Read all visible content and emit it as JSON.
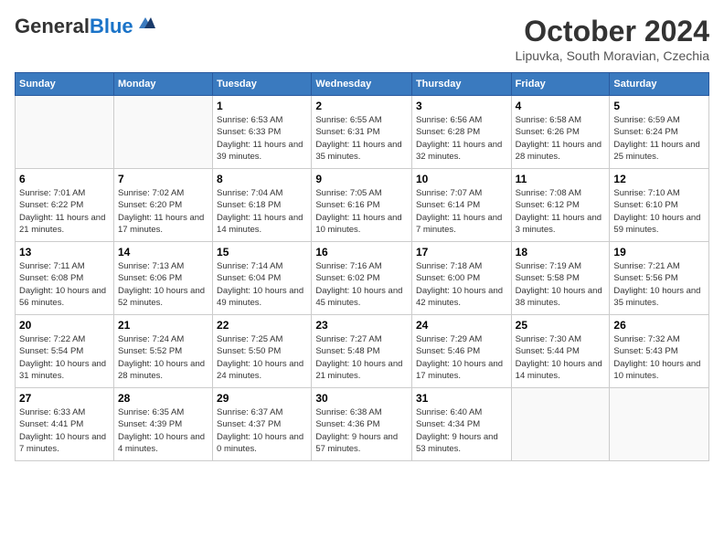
{
  "header": {
    "logo_general": "General",
    "logo_blue": "Blue",
    "title": "October 2024",
    "subtitle": "Lipuvka, South Moravian, Czechia"
  },
  "days_of_week": [
    "Sunday",
    "Monday",
    "Tuesday",
    "Wednesday",
    "Thursday",
    "Friday",
    "Saturday"
  ],
  "weeks": [
    [
      {
        "day": "",
        "info": ""
      },
      {
        "day": "",
        "info": ""
      },
      {
        "day": "1",
        "info": "Sunrise: 6:53 AM\nSunset: 6:33 PM\nDaylight: 11 hours and 39 minutes."
      },
      {
        "day": "2",
        "info": "Sunrise: 6:55 AM\nSunset: 6:31 PM\nDaylight: 11 hours and 35 minutes."
      },
      {
        "day": "3",
        "info": "Sunrise: 6:56 AM\nSunset: 6:28 PM\nDaylight: 11 hours and 32 minutes."
      },
      {
        "day": "4",
        "info": "Sunrise: 6:58 AM\nSunset: 6:26 PM\nDaylight: 11 hours and 28 minutes."
      },
      {
        "day": "5",
        "info": "Sunrise: 6:59 AM\nSunset: 6:24 PM\nDaylight: 11 hours and 25 minutes."
      }
    ],
    [
      {
        "day": "6",
        "info": "Sunrise: 7:01 AM\nSunset: 6:22 PM\nDaylight: 11 hours and 21 minutes."
      },
      {
        "day": "7",
        "info": "Sunrise: 7:02 AM\nSunset: 6:20 PM\nDaylight: 11 hours and 17 minutes."
      },
      {
        "day": "8",
        "info": "Sunrise: 7:04 AM\nSunset: 6:18 PM\nDaylight: 11 hours and 14 minutes."
      },
      {
        "day": "9",
        "info": "Sunrise: 7:05 AM\nSunset: 6:16 PM\nDaylight: 11 hours and 10 minutes."
      },
      {
        "day": "10",
        "info": "Sunrise: 7:07 AM\nSunset: 6:14 PM\nDaylight: 11 hours and 7 minutes."
      },
      {
        "day": "11",
        "info": "Sunrise: 7:08 AM\nSunset: 6:12 PM\nDaylight: 11 hours and 3 minutes."
      },
      {
        "day": "12",
        "info": "Sunrise: 7:10 AM\nSunset: 6:10 PM\nDaylight: 10 hours and 59 minutes."
      }
    ],
    [
      {
        "day": "13",
        "info": "Sunrise: 7:11 AM\nSunset: 6:08 PM\nDaylight: 10 hours and 56 minutes."
      },
      {
        "day": "14",
        "info": "Sunrise: 7:13 AM\nSunset: 6:06 PM\nDaylight: 10 hours and 52 minutes."
      },
      {
        "day": "15",
        "info": "Sunrise: 7:14 AM\nSunset: 6:04 PM\nDaylight: 10 hours and 49 minutes."
      },
      {
        "day": "16",
        "info": "Sunrise: 7:16 AM\nSunset: 6:02 PM\nDaylight: 10 hours and 45 minutes."
      },
      {
        "day": "17",
        "info": "Sunrise: 7:18 AM\nSunset: 6:00 PM\nDaylight: 10 hours and 42 minutes."
      },
      {
        "day": "18",
        "info": "Sunrise: 7:19 AM\nSunset: 5:58 PM\nDaylight: 10 hours and 38 minutes."
      },
      {
        "day": "19",
        "info": "Sunrise: 7:21 AM\nSunset: 5:56 PM\nDaylight: 10 hours and 35 minutes."
      }
    ],
    [
      {
        "day": "20",
        "info": "Sunrise: 7:22 AM\nSunset: 5:54 PM\nDaylight: 10 hours and 31 minutes."
      },
      {
        "day": "21",
        "info": "Sunrise: 7:24 AM\nSunset: 5:52 PM\nDaylight: 10 hours and 28 minutes."
      },
      {
        "day": "22",
        "info": "Sunrise: 7:25 AM\nSunset: 5:50 PM\nDaylight: 10 hours and 24 minutes."
      },
      {
        "day": "23",
        "info": "Sunrise: 7:27 AM\nSunset: 5:48 PM\nDaylight: 10 hours and 21 minutes."
      },
      {
        "day": "24",
        "info": "Sunrise: 7:29 AM\nSunset: 5:46 PM\nDaylight: 10 hours and 17 minutes."
      },
      {
        "day": "25",
        "info": "Sunrise: 7:30 AM\nSunset: 5:44 PM\nDaylight: 10 hours and 14 minutes."
      },
      {
        "day": "26",
        "info": "Sunrise: 7:32 AM\nSunset: 5:43 PM\nDaylight: 10 hours and 10 minutes."
      }
    ],
    [
      {
        "day": "27",
        "info": "Sunrise: 6:33 AM\nSunset: 4:41 PM\nDaylight: 10 hours and 7 minutes."
      },
      {
        "day": "28",
        "info": "Sunrise: 6:35 AM\nSunset: 4:39 PM\nDaylight: 10 hours and 4 minutes."
      },
      {
        "day": "29",
        "info": "Sunrise: 6:37 AM\nSunset: 4:37 PM\nDaylight: 10 hours and 0 minutes."
      },
      {
        "day": "30",
        "info": "Sunrise: 6:38 AM\nSunset: 4:36 PM\nDaylight: 9 hours and 57 minutes."
      },
      {
        "day": "31",
        "info": "Sunrise: 6:40 AM\nSunset: 4:34 PM\nDaylight: 9 hours and 53 minutes."
      },
      {
        "day": "",
        "info": ""
      },
      {
        "day": "",
        "info": ""
      }
    ]
  ]
}
